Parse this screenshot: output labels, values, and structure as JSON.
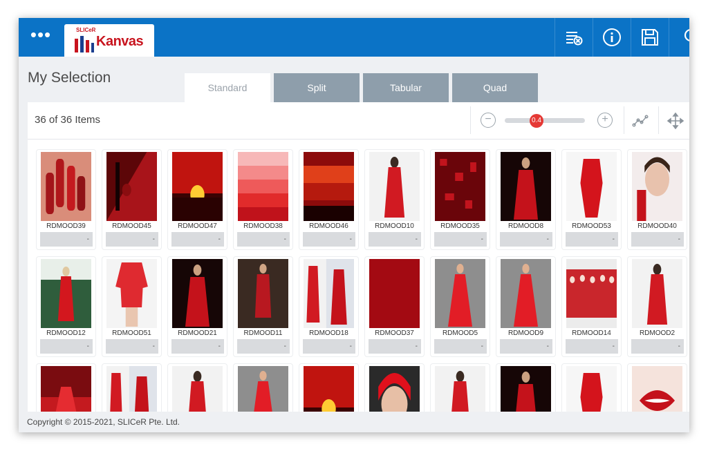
{
  "header": {
    "menu_glyph": "•••",
    "logo_top": "SLICeR",
    "logo_name": "Kanvas",
    "icons": [
      "list-clear-icon",
      "info-icon",
      "save-icon",
      "search-icon"
    ]
  },
  "page": {
    "title": "My Selection",
    "tabs": [
      {
        "label": "Standard",
        "active": true
      },
      {
        "label": "Split",
        "active": false
      },
      {
        "label": "Tabular",
        "active": false
      },
      {
        "label": "Quad",
        "active": false
      }
    ]
  },
  "toolbar": {
    "count": "36 of 36 Items",
    "zoom_minus": "−",
    "zoom_plus": "+",
    "zoom_value": "0.4",
    "zoom_fraction": 0.4
  },
  "colors": {
    "brand": "#0b73c6",
    "accent": "#e53935",
    "tab_inactive": "#8e9eab"
  },
  "items": [
    {
      "label": "RDMOOD39",
      "value": "-",
      "type": "nails"
    },
    {
      "label": "RDMOOD45",
      "value": "-",
      "type": "wine"
    },
    {
      "label": "RDMOOD47",
      "value": "-",
      "type": "sunset"
    },
    {
      "label": "RDMOOD38",
      "value": "-",
      "type": "swatch"
    },
    {
      "label": "RDMOOD46",
      "value": "-",
      "type": "sky"
    },
    {
      "label": "RDMOOD10",
      "value": "-",
      "type": "dress-light"
    },
    {
      "label": "RDMOOD35",
      "value": "-",
      "type": "gems"
    },
    {
      "label": "RDMOOD8",
      "value": "-",
      "type": "dress-dark"
    },
    {
      "label": "RDMOOD53",
      "value": "-",
      "type": "mannequin"
    },
    {
      "label": "RDMOOD40",
      "value": "-",
      "type": "portrait"
    },
    {
      "label": "RDMOOD12",
      "value": "-",
      "type": "dress-green"
    },
    {
      "label": "RDMOOD51",
      "value": "-",
      "type": "blouse"
    },
    {
      "label": "RDMOOD21",
      "value": "-",
      "type": "dress-dark"
    },
    {
      "label": "RDMOOD11",
      "value": "-",
      "type": "dress-brown"
    },
    {
      "label": "RDMOOD18",
      "value": "-",
      "type": "collage"
    },
    {
      "label": "RDMOOD37",
      "value": "-",
      "type": "solid"
    },
    {
      "label": "RDMOOD5",
      "value": "-",
      "type": "gown-grey"
    },
    {
      "label": "RDMOOD9",
      "value": "-",
      "type": "gown-grey"
    },
    {
      "label": "RDMOOD14",
      "value": "-",
      "type": "group"
    },
    {
      "label": "RDMOOD2",
      "value": "-",
      "type": "dress-light"
    },
    {
      "label": "",
      "value": "",
      "type": "gown-red"
    },
    {
      "label": "",
      "value": "",
      "type": "collage"
    },
    {
      "label": "",
      "value": "",
      "type": "dress-light"
    },
    {
      "label": "",
      "value": "",
      "type": "gown-grey"
    },
    {
      "label": "",
      "value": "",
      "type": "sunset"
    },
    {
      "label": "",
      "value": "",
      "type": "redhair"
    },
    {
      "label": "",
      "value": "",
      "type": "dress-light"
    },
    {
      "label": "",
      "value": "",
      "type": "dress-dark"
    },
    {
      "label": "",
      "value": "",
      "type": "mannequin"
    },
    {
      "label": "",
      "value": "",
      "type": "lips"
    }
  ],
  "footer": {
    "copyright": "Copyright © 2015-2021, SLICeR Pte. Ltd."
  }
}
